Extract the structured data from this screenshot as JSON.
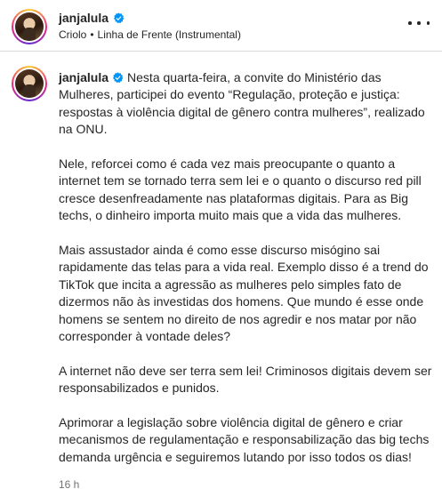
{
  "post": {
    "username": "janjalula",
    "audio": {
      "artist": "Criolo",
      "separator": "•",
      "track": "Linha de Frente (Instrumental)"
    },
    "more_icon": "more-horizontal-icon",
    "verified_icon": "verified-badge-icon",
    "verified_color": "#0095f6"
  },
  "caption": {
    "username": "janjalula",
    "paragraphs": [
      "Nesta quarta-feira, a convite do Ministério das Mulheres, participei do evento “Regulação, proteção e justiça: respostas à violência digital de gênero contra mulheres”, realizado na ONU.",
      "Nele, reforcei como é cada vez mais preocupante o quanto a internet tem se tornado terra sem lei e o quanto o discurso red pill cresce desenfreadamente nas plataformas digitais. Para as Big techs, o dinheiro importa muito mais que a vida das mulheres.",
      "Mais assustador ainda é como esse discurso misógino sai rapidamente das telas para a vida real. Exemplo disso é a trend do TikTok que incita a agressão as mulheres pelo simples fato de dizermos não às investidas dos homens. Que mundo é esse onde homens se sentem no direito de nos agredir e nos matar por não corresponder à vontade deles?",
      "A internet não deve ser terra sem lei! Criminosos digitais devem ser responsabilizados e punidos.",
      "Aprimorar a legislação sobre violência digital de gênero e criar mecanismos de regulamentação e responsabilização das big techs demanda urgência e seguiremos lutando por isso todos os dias!"
    ],
    "timestamp": "16 h"
  }
}
